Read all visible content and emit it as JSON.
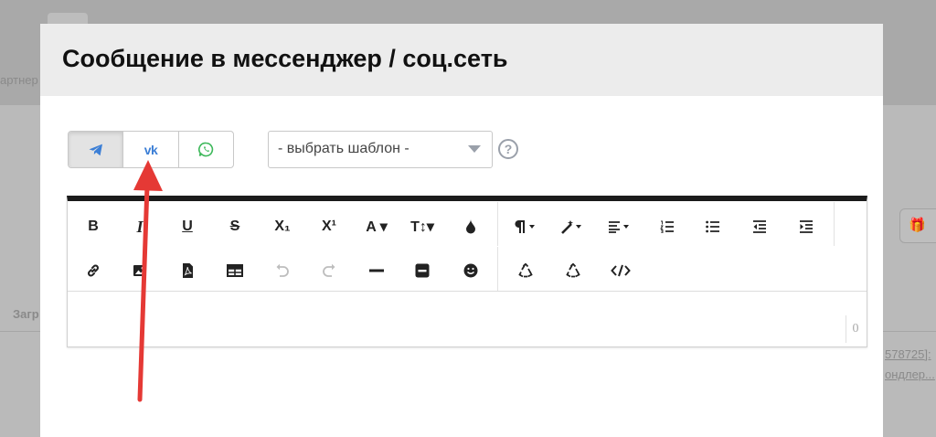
{
  "background": {
    "left_label": "артнер",
    "left_label2": "Загр",
    "right_link1": "578725]:",
    "right_link2": "ондлер..."
  },
  "modal": {
    "title": "Сообщение в мессенджер / соц.сеть",
    "channels": [
      {
        "name": "telegram-icon",
        "active": true
      },
      {
        "name": "vk",
        "label": "vk",
        "active": false
      },
      {
        "name": "whatsapp-icon",
        "active": false
      }
    ],
    "template_select": {
      "selected": "- выбрать шаблон -"
    },
    "help_label": "?",
    "editor": {
      "toolbar": {
        "bold": "B",
        "italic": "I",
        "underline": "U",
        "strike": "S",
        "subscript": "X₁",
        "superscript": "X¹",
        "font_color": "A ▾",
        "font_size": "T↕▾"
      },
      "char_count": "0"
    }
  },
  "colors": {
    "accent_blue": "#3c7fd6",
    "telegram": "#3c7fd6",
    "whatsapp": "#3db85a",
    "arrow": "#e53935",
    "overlay": "#ababab"
  }
}
